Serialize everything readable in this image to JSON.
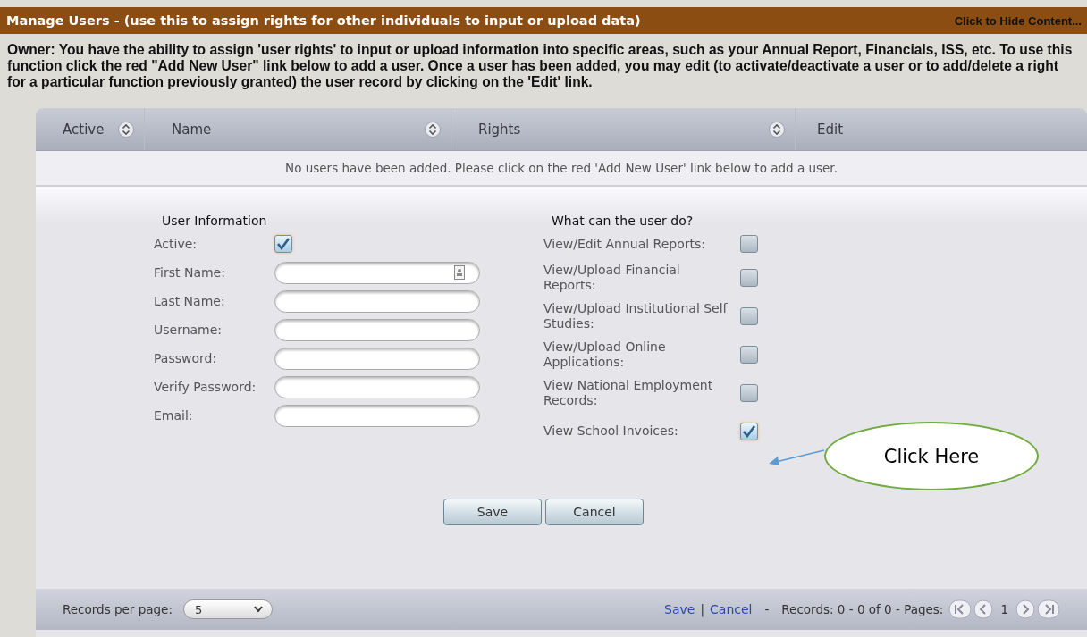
{
  "header": {
    "title": "Manage Users - (use this to assign rights for other individuals to input or upload data)",
    "toggle_link": "Click to Hide Content..."
  },
  "intro": "Owner: You have the ability to assign 'user rights' to input or upload information into specific areas, such as your Annual Report, Financials, ISS, etc. To use this function click the red \"Add New User\" link below to add a user. Once a user has been added, you may edit (to activate/deactivate a user or to add/delete a right for a particular function previously granted) the user record by clicking on the 'Edit' link.",
  "table": {
    "columns": [
      {
        "label": "Active",
        "sortable": true
      },
      {
        "label": "Name",
        "sortable": true
      },
      {
        "label": "Rights",
        "sortable": true
      },
      {
        "label": "Edit",
        "sortable": false
      }
    ],
    "empty_message": "No users have been added. Please click on the red 'Add New User' link below to add a user."
  },
  "user_info": {
    "title": "User Information",
    "active": {
      "label": "Active:",
      "checked": true
    },
    "fields": [
      {
        "label": "First Name:",
        "contact_icon": true
      },
      {
        "label": "Last Name:",
        "contact_icon": false
      },
      {
        "label": "Username:",
        "contact_icon": false
      },
      {
        "label": "Password:",
        "contact_icon": false
      },
      {
        "label": "Verify Password:",
        "contact_icon": false
      },
      {
        "label": "Email:",
        "contact_icon": false
      }
    ]
  },
  "rights": {
    "title": "What can the user do?",
    "items": [
      {
        "label": "View/Edit Annual Reports:",
        "checked": false
      },
      {
        "label": "View/Upload Financial Reports:",
        "checked": false
      },
      {
        "label": "View/Upload Institutional Self Studies:",
        "checked": false
      },
      {
        "label": "View/Upload Online Applications:",
        "checked": false
      },
      {
        "label": "View National Employment Records:",
        "checked": false
      },
      {
        "label": "View School Invoices:",
        "checked": true
      }
    ]
  },
  "callout": {
    "text": "Click Here"
  },
  "buttons": [
    "Save",
    "Cancel"
  ],
  "footer": {
    "records_per_page_label": "Records per page:",
    "records_per_page": "5",
    "links": [
      "Save",
      "Cancel"
    ],
    "separator": "|",
    "dash": "-",
    "records": "Records: 0 - 0 of 0 - Pages:",
    "page": "1"
  }
}
